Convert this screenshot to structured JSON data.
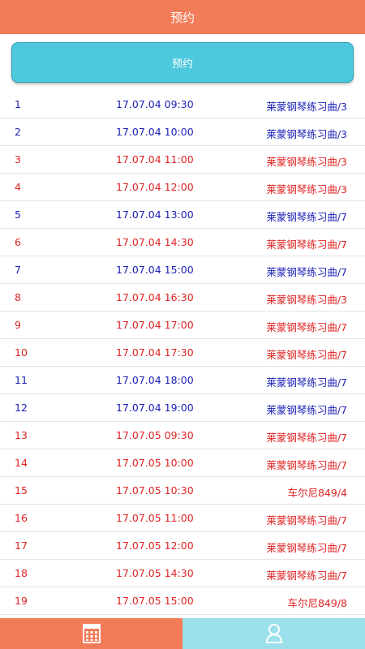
{
  "header": {
    "title": "预约"
  },
  "reserve_button": {
    "label": "预约"
  },
  "rows": [
    {
      "num": "1",
      "time": "17.07.04 09:30",
      "piece": "莱蒙钢琴练习曲/3",
      "color": "blue"
    },
    {
      "num": "2",
      "time": "17.07.04 10:00",
      "piece": "莱蒙钢琴练习曲/3",
      "color": "blue"
    },
    {
      "num": "3",
      "time": "17.07.04 11:00",
      "piece": "莱蒙钢琴练习曲/3",
      "color": "red"
    },
    {
      "num": "4",
      "time": "17.07.04 12:00",
      "piece": "莱蒙钢琴练习曲/3",
      "color": "red"
    },
    {
      "num": "5",
      "time": "17.07.04 13:00",
      "piece": "莱蒙钢琴练习曲/7",
      "color": "blue"
    },
    {
      "num": "6",
      "time": "17.07.04 14:30",
      "piece": "莱蒙钢琴练习曲/7",
      "color": "red"
    },
    {
      "num": "7",
      "time": "17.07.04 15:00",
      "piece": "莱蒙钢琴练习曲/7",
      "color": "blue"
    },
    {
      "num": "8",
      "time": "17.07.04 16:30",
      "piece": "莱蒙钢琴练习曲/3",
      "color": "red"
    },
    {
      "num": "9",
      "time": "17.07.04 17:00",
      "piece": "莱蒙钢琴练习曲/7",
      "color": "red"
    },
    {
      "num": "10",
      "time": "17.07.04 17:30",
      "piece": "莱蒙钢琴练习曲/7",
      "color": "red"
    },
    {
      "num": "11",
      "time": "17.07.04 18:00",
      "piece": "莱蒙钢琴练习曲/7",
      "color": "blue"
    },
    {
      "num": "12",
      "time": "17.07.04 19:00",
      "piece": "莱蒙钢琴练习曲/7",
      "color": "blue"
    },
    {
      "num": "13",
      "time": "17.07.05 09:30",
      "piece": "莱蒙钢琴练习曲/7",
      "color": "red"
    },
    {
      "num": "14",
      "time": "17.07.05 10:00",
      "piece": "莱蒙钢琴练习曲/7",
      "color": "red"
    },
    {
      "num": "15",
      "time": "17.07.05 10:30",
      "piece": "车尔尼849/4",
      "color": "red"
    },
    {
      "num": "16",
      "time": "17.07.05 11:00",
      "piece": "莱蒙钢琴练习曲/7",
      "color": "red"
    },
    {
      "num": "17",
      "time": "17.07.05 12:00",
      "piece": "莱蒙钢琴练习曲/7",
      "color": "red"
    },
    {
      "num": "18",
      "time": "17.07.05 14:30",
      "piece": "莱蒙钢琴练习曲/7",
      "color": "red"
    },
    {
      "num": "19",
      "time": "17.07.05 15:00",
      "piece": "车尔尼849/8",
      "color": "red"
    }
  ],
  "tabs": [
    {
      "icon": "calendar-icon"
    },
    {
      "icon": "person-icon"
    }
  ],
  "colors": {
    "accent": "#f27b58",
    "button": "#4ec8dc",
    "tab_right": "#9be0ea",
    "available_text": "#1a1fb5",
    "booked_text": "#e02424"
  }
}
